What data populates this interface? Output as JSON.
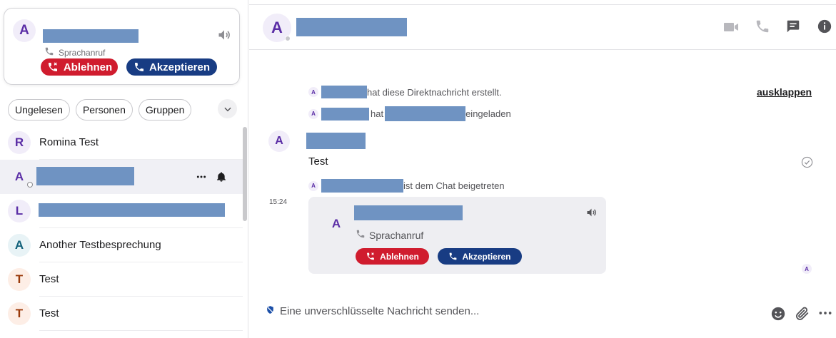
{
  "incoming_call": {
    "avatar_letter": "A",
    "subtitle": "Sprachanruf",
    "decline_label": "Ablehnen",
    "accept_label": "Akzeptieren"
  },
  "filters": [
    "Ungelesen",
    "Personen",
    "Gruppen"
  ],
  "conversations": [
    {
      "letter": "R",
      "label": "Romina Test",
      "color": "purple"
    },
    {
      "letter": "A",
      "label": "",
      "color": "purple"
    },
    {
      "letter": "L",
      "label": "",
      "color": "purple"
    },
    {
      "letter": "A",
      "label": "Another Testbesprechung",
      "color": "teal"
    },
    {
      "letter": "T",
      "label": "Test",
      "color": "orange"
    },
    {
      "letter": "T",
      "label": "Test",
      "color": "orange"
    }
  ],
  "chat_header": {
    "avatar_letter": "A"
  },
  "system_messages": {
    "created": "hat diese Direktnachricht erstellt.",
    "invited_prefix": "hat",
    "invited_suffix": "eingeladen",
    "joined": "ist dem Chat beigetreten",
    "mini_letter": "A"
  },
  "expand_label": "ausklappen",
  "message": {
    "avatar_letter": "A",
    "text": "Test",
    "time": "15:24"
  },
  "call_card": {
    "avatar_letter": "A",
    "subtitle": "Sprachanruf",
    "decline_label": "Ablehnen",
    "accept_label": "Akzeptieren"
  },
  "composer": {
    "placeholder": "Eine unverschlüsselte Nachricht senden..."
  },
  "colors": {
    "decline": "#d01c2e",
    "accept": "#183c83",
    "redaction": "#6f93c2"
  }
}
